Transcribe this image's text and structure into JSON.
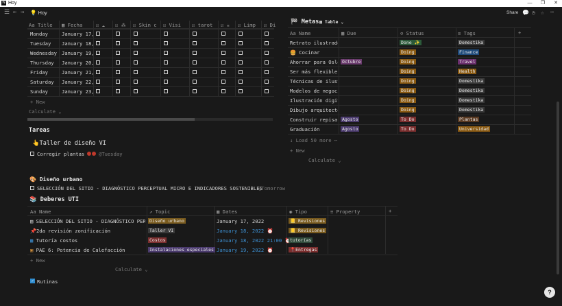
{
  "window": {
    "title": "Hoy",
    "controls": [
      "—",
      "❐",
      "✕"
    ]
  },
  "topbar": {
    "page_icon": "💡",
    "page_title": "Hoy",
    "share": "Share"
  },
  "weekly": {
    "headers": [
      "Title",
      "Fecha",
      "☁",
      "⁂",
      "Skin c",
      "Visi",
      "tarot",
      "☕",
      "Limp",
      "Di"
    ],
    "rows": [
      {
        "day": "Monday",
        "date": "January 17,"
      },
      {
        "day": "Tuesday",
        "date": "January 18,"
      },
      {
        "day": "Wednesday",
        "date": "January 19,"
      },
      {
        "day": "Thursday",
        "date": "January 20,"
      },
      {
        "day": "Friday",
        "date": "January 21,"
      },
      {
        "day": "Saturday",
        "date": "January 22,"
      },
      {
        "day": "Sunday",
        "date": "January 23,"
      }
    ],
    "new_label": "+ New",
    "calculate_label": "Calculate ⌄"
  },
  "tareas": {
    "title": "Tareas",
    "sub_title": "Taller de diseño VI",
    "task": "Corregir plantas",
    "task_date": "@Tuesday"
  },
  "diseno": {
    "title": "Diseño urbano",
    "task": "SELECCIÓN DEL SITIO - DIAGNÓSTICO PERCEPTUAL MICRO E INDICADORES SOSTENIBLES",
    "task_date": "@Tomorrow"
  },
  "deberes": {
    "title": "Deberes UTI",
    "headers": [
      "Name",
      "Topic",
      "Dates",
      "Tipo",
      "Property",
      "+"
    ],
    "rows": [
      {
        "name": "SELECCIÓN DEL SITIO - DIAGNÓSTICO PERCEP",
        "topic": "Diseño urbano",
        "topic_color": "#7a5b1e",
        "date": "January 17, 2022",
        "date_extra": "",
        "date_color": "#d4d4d4",
        "tipo": "📒 Revisiones",
        "tipo_color": "#7a5b1e"
      },
      {
        "name": "2da revisión zonificación",
        "topic": "Taller VI",
        "topic_color": "#3a3a3a",
        "date": "January 18, 2022",
        "date_extra": "⏰",
        "date_color": "#3d8fd1",
        "tipo": "📒 Revisiones",
        "tipo_color": "#7a5b1e"
      },
      {
        "name": "Tutoría costos",
        "topic": "Costos",
        "topic_color": "#7c2f2f",
        "date": "January 18, 2022 21:00",
        "date_extra": "⏰",
        "date_color": "#3d8fd1",
        "tipo": "tutorías",
        "tipo_color": "#2f4a3a"
      },
      {
        "name": "PAE 6: Potencia de Calefacción",
        "topic": "Instalaciones especiales",
        "topic_color": "#4b3b6e",
        "date": "January 19, 2022",
        "date_extra": "⏰",
        "date_color": "#3d8fd1",
        "tipo": "📍Entregas",
        "tipo_color": "#7c2f2f"
      }
    ],
    "new_label": "+ New",
    "calculate_label": "Calculate ⌄"
  },
  "rutinas": {
    "label": "Rutinas",
    "checked": true
  },
  "metas": {
    "title": "Metas",
    "view_label": "Table ⌄",
    "headers": [
      "Name",
      "Due",
      "Status",
      "Tags",
      "+"
    ],
    "rows": [
      {
        "name": "Retrato ilustrado c",
        "due": "",
        "due_color": "",
        "status": "Done ✨",
        "status_color": "#2c5a3a",
        "tag": "Domestika",
        "tag_color": "#3a3a3a"
      },
      {
        "name": "🍔 Cocinar",
        "due": "",
        "due_color": "",
        "status": "Doing",
        "status_color": "#8a5a12",
        "tag": "Finance",
        "tag_color": "#1e4a7a"
      },
      {
        "name": "Ahorrar para Oslo",
        "due": "Octubre",
        "due_color": "#6b3b6e",
        "status": "Doing",
        "status_color": "#8a5a12",
        "tag": "Travel",
        "tag_color": "#6b2f6e"
      },
      {
        "name": "Ser más flexible",
        "due": "",
        "due_color": "",
        "status": "Doing",
        "status_color": "#8a5a12",
        "tag": "Health",
        "tag_color": "#8a5a12"
      },
      {
        "name": "Técnicas de ilustr",
        "due": "",
        "due_color": "",
        "status": "Doing",
        "status_color": "#8a5a12",
        "tag": "Domestika",
        "tag_color": "#3a3a3a"
      },
      {
        "name": "Modelos de negocio",
        "due": "",
        "due_color": "",
        "status": "Doing",
        "status_color": "#8a5a12",
        "tag": "Domestika",
        "tag_color": "#3a3a3a"
      },
      {
        "name": "Ilustración digital",
        "due": "",
        "due_color": "",
        "status": "Doing",
        "status_color": "#8a5a12",
        "tag": "Domestika",
        "tag_color": "#3a3a3a"
      },
      {
        "name": "Dibujo arquitectón",
        "due": "",
        "due_color": "",
        "status": "Doing",
        "status_color": "#8a5a12",
        "tag": "Domestika",
        "tag_color": "#3a3a3a"
      },
      {
        "name": "Construir repisa de",
        "due": "Agosto",
        "due_color": "#4b3b6e",
        "status": "To Do",
        "status_color": "#7c2f2f",
        "tag": "Plantas",
        "tag_color": "#5a3a22"
      },
      {
        "name": "Graduación",
        "due": "Agosto",
        "due_color": "#4b3b6e",
        "status": "To Do",
        "status_color": "#7c2f2f",
        "tag": "Universidad",
        "tag_color": "#8a5a12"
      }
    ],
    "load_more": "↓ Load 50 more ⋯",
    "new_label": "+ New",
    "calculate_label": "Calculate ⌄"
  },
  "help": "?"
}
